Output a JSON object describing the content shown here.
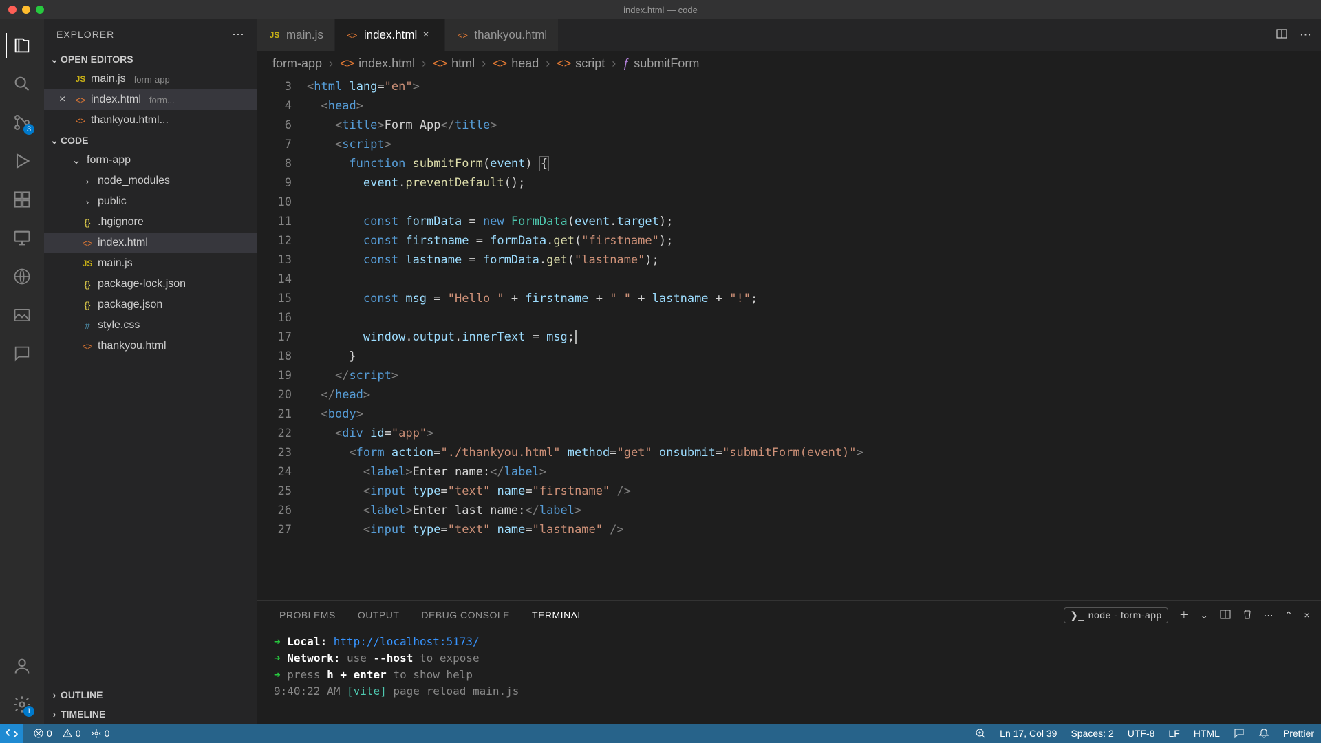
{
  "window": {
    "title": "index.html — code"
  },
  "sidebar": {
    "title": "EXPLORER",
    "sections": {
      "openEditors": {
        "label": "OPEN EDITORS",
        "items": [
          {
            "icon": "JS",
            "name": "main.js",
            "hint": "form-app"
          },
          {
            "icon": "<>",
            "name": "index.html",
            "hint": "form...",
            "active": true
          },
          {
            "icon": "<>",
            "name": "thankyou.html...",
            "hint": ""
          }
        ]
      },
      "workspace": {
        "label": "CODE",
        "folder": "form-app",
        "items": [
          {
            "icon": ">",
            "name": "node_modules",
            "type": "folder"
          },
          {
            "icon": ">",
            "name": "public",
            "type": "folder"
          },
          {
            "icon": "{}",
            "name": ".hgignore",
            "type": "json"
          },
          {
            "icon": "<>",
            "name": "index.html",
            "type": "html",
            "active": true
          },
          {
            "icon": "JS",
            "name": "main.js",
            "type": "js"
          },
          {
            "icon": "{}",
            "name": "package-lock.json",
            "type": "json"
          },
          {
            "icon": "{}",
            "name": "package.json",
            "type": "json"
          },
          {
            "icon": "#",
            "name": "style.css",
            "type": "css"
          },
          {
            "icon": "<>",
            "name": "thankyou.html",
            "type": "html"
          }
        ]
      },
      "outline": {
        "label": "OUTLINE"
      },
      "timeline": {
        "label": "TIMELINE"
      }
    }
  },
  "activitybar": {
    "badge_scm": "3",
    "badge_account": "1"
  },
  "tabs": [
    {
      "icon": "JS",
      "label": "main.js",
      "active": false
    },
    {
      "icon": "<>",
      "label": "index.html",
      "active": true,
      "close": "×"
    },
    {
      "icon": "<>",
      "label": "thankyou.html",
      "active": false
    }
  ],
  "breadcrumbs": [
    {
      "label": "form-app"
    },
    {
      "label": "index.html",
      "icon": "<>"
    },
    {
      "label": "html",
      "icon": "<>"
    },
    {
      "label": "head",
      "icon": "<>"
    },
    {
      "label": "script",
      "icon": "<>"
    },
    {
      "label": "submitForm",
      "icon": "ƒ"
    }
  ],
  "editor": {
    "line_numbers": [
      "3",
      "4",
      "6",
      "7",
      "8",
      "9",
      "10",
      "11",
      "12",
      "13",
      "14",
      "15",
      "16",
      "17",
      "18",
      "19",
      "20",
      "21",
      "22",
      "23",
      "24",
      "25",
      "26",
      "27"
    ]
  },
  "code": {
    "l3": {
      "pre": "<",
      "tag": "html",
      "attr": "lang",
      "val": "\"en\"",
      "post": ">"
    },
    "l4": {
      "pre": "<",
      "tag": "head",
      "post": ">"
    },
    "l6": {
      "open": "<",
      "tag": "title",
      "mid": ">",
      "text": "Form App",
      "close": "</",
      "tag2": "title",
      "end": ">"
    },
    "l7": {
      "open": "<",
      "tag": "script",
      "end": ">"
    },
    "l8": {
      "kw": "function",
      "fn": "submitForm",
      "sig": "(",
      "arg": "event",
      "sig2": ") ",
      "brace": "{"
    },
    "l9": {
      "obj": "event",
      "dot": ".",
      "fn": "preventDefault",
      "paren": "();"
    },
    "l11": {
      "kw": "const",
      "var": "formData",
      "eq": " = ",
      "kw2": "new",
      "cls": "FormData",
      "open": "(",
      "arg": "event",
      "dot": ".",
      "prop": "target",
      "close": ");"
    },
    "l12": {
      "kw": "const",
      "var": "firstname",
      "eq": " = ",
      "obj": "formData",
      "dot": ".",
      "fn": "get",
      "open": "(",
      "str": "\"firstname\"",
      "close": ");"
    },
    "l13": {
      "kw": "const",
      "var": "lastname",
      "eq": " = ",
      "obj": "formData",
      "dot": ".",
      "fn": "get",
      "open": "(",
      "str": "\"lastname\"",
      "close": ");"
    },
    "l15": {
      "kw": "const",
      "var": "msg",
      "eq": " = ",
      "s1": "\"Hello \"",
      "p1": " + ",
      "v1": "firstname",
      "p2": " + ",
      "s2": "\" \"",
      "p3": " + ",
      "v2": "lastname",
      "p4": " + ",
      "s3": "\"!\"",
      "end": ";"
    },
    "l17": {
      "o1": "window",
      "d1": ".",
      "o2": "output",
      "d2": ".",
      "o3": "innerText",
      "eq": " = ",
      "v": "msg",
      "end": ";"
    },
    "l18": {
      "brace": "}"
    },
    "l19": {
      "open": "</",
      "tag": "script",
      "end": ">"
    },
    "l20": {
      "open": "</",
      "tag": "head",
      "end": ">"
    },
    "l21": {
      "open": "<",
      "tag": "body",
      "end": ">"
    },
    "l22": {
      "open": "<",
      "tag": "div",
      "attr": "id",
      "val": "\"app\"",
      "end": ">"
    },
    "l23": {
      "open": "<",
      "tag": "form",
      "a1": "action",
      "v1": "\"./thankyou.html\"",
      "a2": "method",
      "v2": "\"get\"",
      "a3": "onsubmit",
      "v3": "\"submitForm(event)\"",
      "end": ">"
    },
    "l24": {
      "open": "<",
      "tag": "label",
      "mid": ">",
      "text": "Enter name:",
      "close": "</",
      "tag2": "label",
      "end": ">"
    },
    "l25": {
      "open": "<",
      "tag": "input",
      "a1": "type",
      "v1": "\"text\"",
      "a2": "name",
      "v2": "\"firstname\"",
      "end": " />"
    },
    "l26": {
      "open": "<",
      "tag": "label",
      "mid": ">",
      "text": "Enter last name:",
      "close": "</",
      "tag2": "label",
      "end": ">"
    },
    "l27": {
      "open": "<",
      "tag": "input",
      "a1": "type",
      "v1": "\"text\"",
      "a2": "name",
      "v2": "\"lastname\"",
      "end": " />"
    }
  },
  "panel": {
    "tabs": [
      "PROBLEMS",
      "OUTPUT",
      "DEBUG CONSOLE",
      "TERMINAL"
    ],
    "active_tab": "TERMINAL",
    "term_label": "node - form-app",
    "terminal": {
      "line1_label": "Local:",
      "line1_url": "http://localhost:5173/",
      "line2_label": "Network:",
      "line2_text": "use",
      "line2_flag": "--host",
      "line2_rest": "to expose",
      "line3_text": "press",
      "line3_key": "h + enter",
      "line3_rest": "to show help",
      "line4_time": "9:40:22 AM",
      "line4_tag": "[vite]",
      "line4_rest": "page reload main.js"
    }
  },
  "statusbar": {
    "errors": "0",
    "warnings": "0",
    "ports": "0",
    "lncol": "Ln 17, Col 39",
    "spaces": "Spaces: 2",
    "encoding": "UTF-8",
    "eol": "LF",
    "lang": "HTML",
    "bell": "",
    "prettier": "Prettier"
  }
}
